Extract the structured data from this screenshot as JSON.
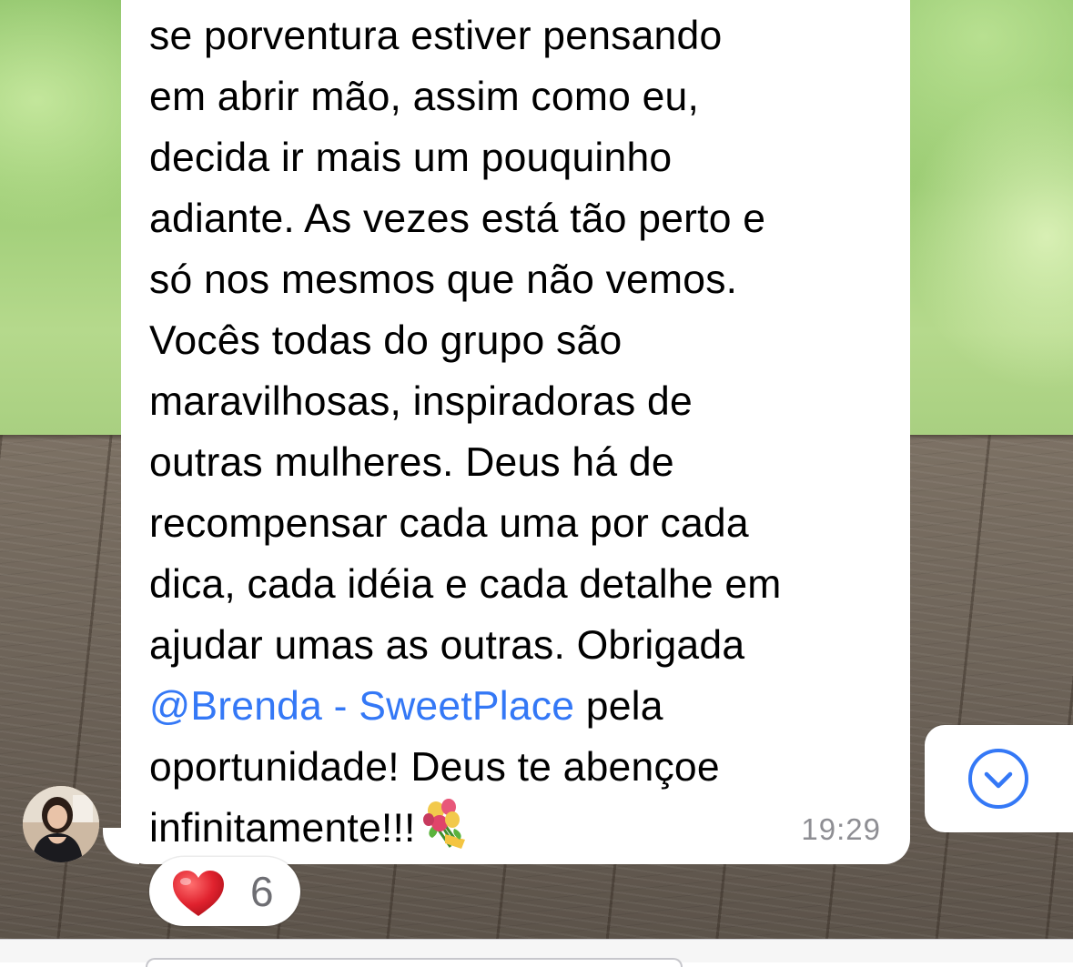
{
  "message": {
    "lines": [
      "se porventura estiver pensando",
      "em abrir mão, assim como eu,",
      "decida ir mais um pouquinho",
      "adiante. As vezes está tão perto e",
      "só nos mesmos que não vemos.",
      "Vocês todas do grupo são",
      "maravilhosas, inspiradoras de",
      "outras mulheres. Deus há de",
      "recompensar cada uma por cada",
      "dica, cada idéia e cada detalhe em",
      "ajudar umas as outras. Obrigada"
    ],
    "mention": "@Brenda - SweetPlace",
    "after_mention": " pela",
    "line_13": "oportunidade! Deus te abençoe",
    "line_14": "infinitamente!!!",
    "emoji": "bouquet-emoji",
    "time": "19:29"
  },
  "reaction": {
    "emoji": "heart-emoji",
    "count": "6"
  },
  "colors": {
    "mention": "#3478f6",
    "timestamp": "#8e8e93",
    "scroll_button_accent": "#3478f6",
    "heart": "#e0222e"
  },
  "icons": {
    "scroll_down": "chevron-down-circle-icon"
  }
}
